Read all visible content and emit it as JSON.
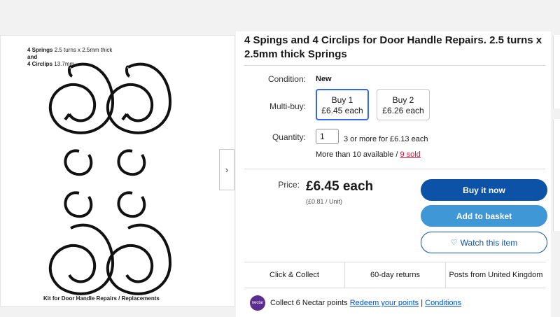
{
  "gallery": {
    "image_title_bold_1": "4 Springs",
    "image_title_rest_1": "2.5 turns x 2.5mm thick",
    "image_title_and": "and",
    "image_title_bold_2": "4 Circlips",
    "image_title_rest_2": "13.7mm",
    "image_caption": "Kit for Door Handle Repairs / Replacements",
    "next_icon": "chevron-right-icon"
  },
  "listing": {
    "title": "4 Spings and 4 Circlips for Door Handle Repairs. 2.5 turns x 2.5mm thick Springs",
    "condition_label": "Condition:",
    "condition_value": "New",
    "multibuy_label": "Multi-buy:",
    "multibuy_options": [
      {
        "line1": "Buy 1",
        "line2": "£6.45 each"
      },
      {
        "line1": "Buy 2",
        "line2": "£6.26 each"
      }
    ],
    "quantity_label": "Quantity:",
    "quantity_value": "1",
    "quantity_offer": "3 or more for £6.13 each",
    "availability": "More than 10 available / ",
    "sold": "9 sold",
    "price_label": "Price:",
    "price": "£6.45 each",
    "unit_price": "(£0.81 / Unit)"
  },
  "buttons": {
    "buy_now": "Buy it now",
    "add_to_basket": "Add to basket",
    "watch": "Watch this item"
  },
  "features": [
    "Click & Collect",
    "60-day returns",
    "Posts from United Kingdom"
  ],
  "nectar": {
    "logo": "nectar",
    "text": "Collect 6 Nectar points",
    "redeem": "Redeem your points",
    "separator": "|",
    "conditions": "Conditions"
  },
  "colors": {
    "primary": "#0c53a8",
    "secondary": "#3f97d6",
    "sold": "#e0103a",
    "nectar": "#5b2d8e"
  }
}
